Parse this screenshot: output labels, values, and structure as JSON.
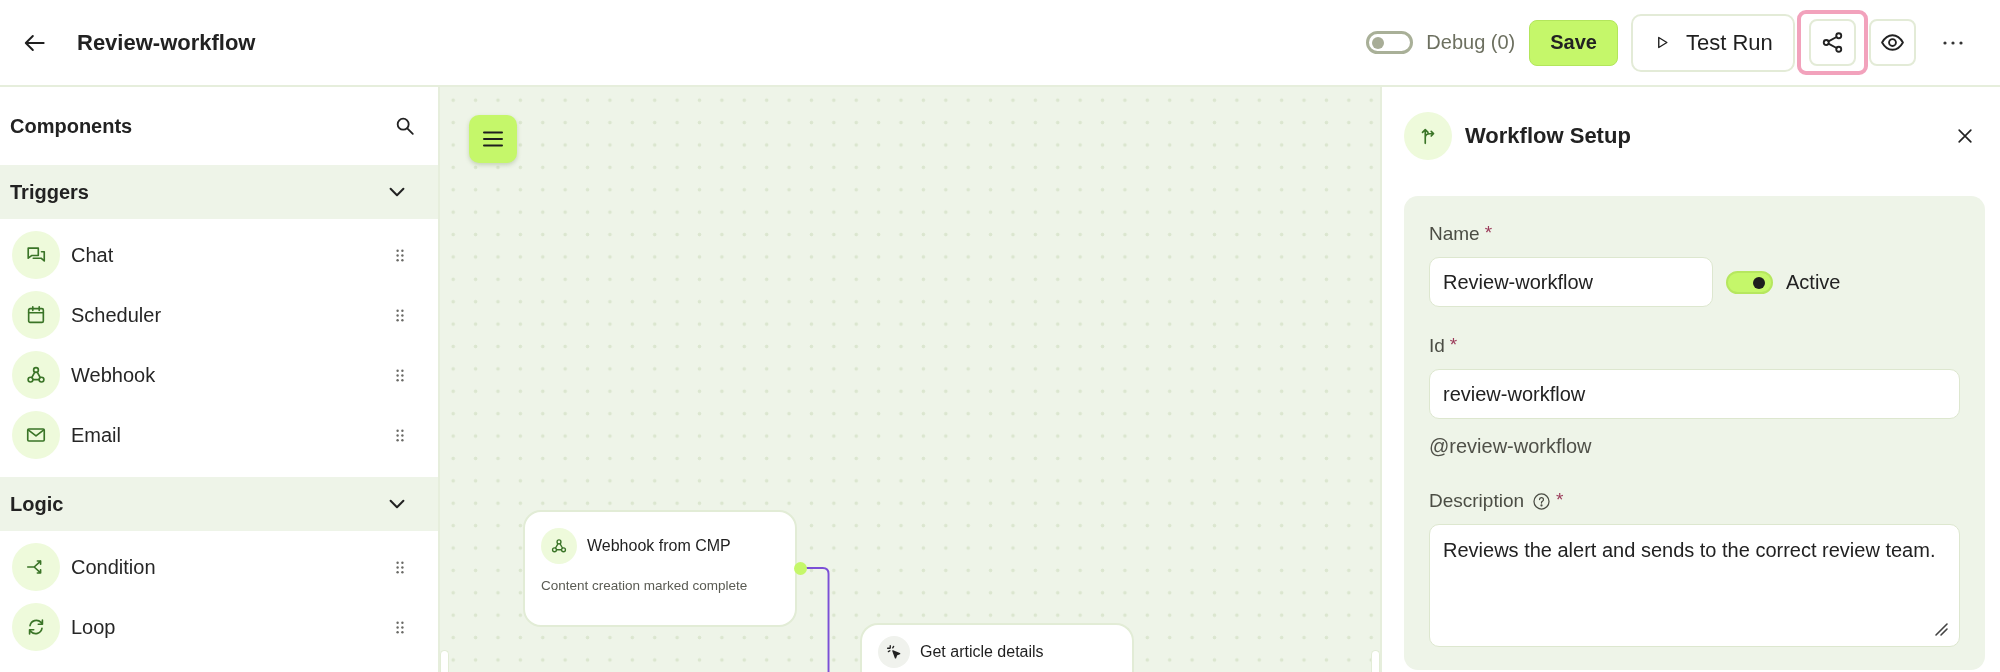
{
  "header": {
    "title": "Review-workflow",
    "debug": {
      "label": "Debug (0)",
      "on": false
    },
    "save": "Save",
    "test_run": "Test Run",
    "share": {
      "highlighted": true
    }
  },
  "sidebar": {
    "title": "Components",
    "sections": [
      {
        "title": "Triggers",
        "expanded": true,
        "items": [
          {
            "label": "Chat",
            "kind": "chat"
          },
          {
            "label": "Scheduler",
            "kind": "scheduler"
          },
          {
            "label": "Webhook",
            "kind": "webhook"
          },
          {
            "label": "Email",
            "kind": "email"
          }
        ]
      },
      {
        "title": "Logic",
        "expanded": true,
        "items": [
          {
            "label": "Condition",
            "kind": "condition"
          },
          {
            "label": "Loop",
            "kind": "loop"
          }
        ]
      }
    ]
  },
  "canvas": {
    "nodes": [
      {
        "title": "Webhook from CMP",
        "subtitle": "Content creation marked complete",
        "kind": "webhook"
      },
      {
        "title": "Get article details",
        "kind": "action"
      }
    ]
  },
  "panel": {
    "title": "Workflow Setup",
    "fields": [
      {
        "kind": "input",
        "label": "Name",
        "required_mark": "*",
        "help": false,
        "value": "Review-workflow",
        "toggle": {
          "label": "Active",
          "on": true
        }
      },
      {
        "kind": "input",
        "label": "Id",
        "required_mark": "*",
        "help": false,
        "value": "review-workflow",
        "hint": "@review-workflow"
      },
      {
        "kind": "textarea",
        "label": "Description",
        "required_mark": "*",
        "help": true,
        "value": "Reviews the alert and sends to the correct review team."
      }
    ]
  }
}
